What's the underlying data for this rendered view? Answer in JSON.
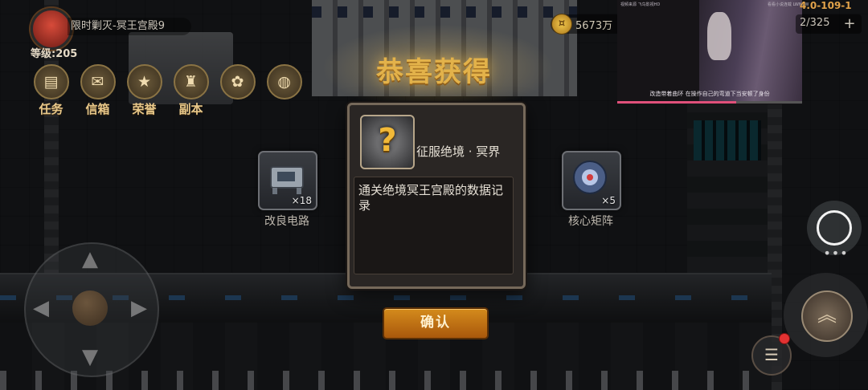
{
  "hud": {
    "stage_name": "限时剿灭-冥王宫殿9",
    "player_level": "等级:205",
    "menu": [
      {
        "label": "任务",
        "icon": "task-icon",
        "glyph": "▤"
      },
      {
        "label": "信箱",
        "icon": "mailbox-icon",
        "glyph": "✉"
      },
      {
        "label": "荣誉",
        "icon": "honor-icon",
        "glyph": "★"
      },
      {
        "label": "副本",
        "icon": "dungeon-icon",
        "glyph": "♜"
      },
      {
        "label": "",
        "icon": "badge-icon",
        "glyph": "✿"
      },
      {
        "label": "",
        "icon": "globe-icon",
        "glyph": "◍"
      }
    ],
    "coins": "5673万",
    "stage_code": "4.0-109-1",
    "counter": "2/325",
    "plus": "+"
  },
  "video": {
    "top_left": "视频来源  飞鸟影视HD",
    "top_right": "看看小说连载 LWNOW",
    "subtitle": "改造带着曲环  在操作自己的弯道下当安顿了身份"
  },
  "reward": {
    "banner": "恭喜获得",
    "items": [
      {
        "name": "改良电路",
        "count": "×18",
        "icon": "circuit-icon"
      },
      {
        "name": "核心矩阵",
        "count": "×5",
        "icon": "core-matrix-icon"
      }
    ]
  },
  "dialog": {
    "icon_glyph": "?",
    "title": "征服绝境 · 冥界",
    "description": "通关绝境冥王宫殿的数据记录"
  },
  "confirm_label": "确认",
  "controls": {
    "more": "•••",
    "action_glyph": "︽",
    "list_glyph": "☰"
  },
  "colors": {
    "accent_gold": "#e3b24a",
    "button_orange": "#d48b1c",
    "notification_red": "#e33232"
  }
}
